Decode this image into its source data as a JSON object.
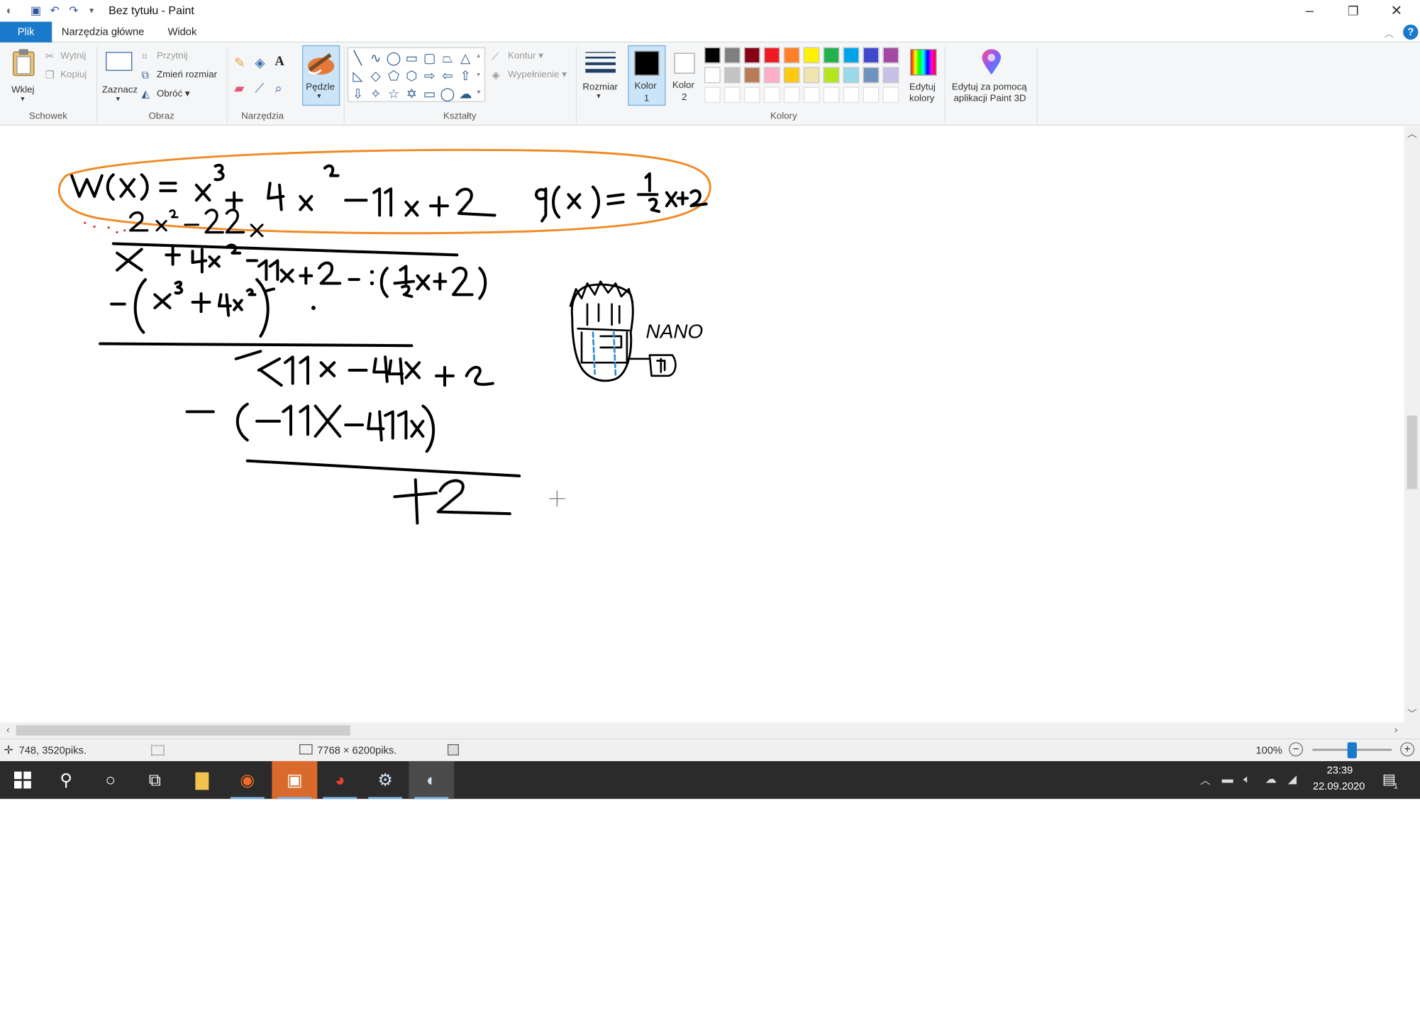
{
  "window": {
    "title": "Bez tytułu - Paint",
    "quick_access": [
      "save-icon",
      "undo-icon",
      "redo-icon",
      "customize-icon"
    ]
  },
  "tabs": [
    {
      "label": "Plik"
    },
    {
      "label": "Narzędzia główne"
    },
    {
      "label": "Widok"
    }
  ],
  "ribbon": {
    "groups": {
      "schowek": "Schowek",
      "obraz": "Obraz",
      "narzedzia": "Narzędzia",
      "ksztalty": "Kształty",
      "kolory": "Kolory"
    },
    "wklej": "Wklej",
    "wytnij": "Wytnij",
    "kopiuj": "Kopiuj",
    "zaznacz": "Zaznacz",
    "przytnij": "Przytnij",
    "zmien_rozmiar": "Zmień rozmiar",
    "obroc": "Obróć",
    "pedzle": "Pędzle",
    "kontur": "Kontur",
    "wypelnienie": "Wypełnienie",
    "rozmiar": "Rozmiar",
    "kolor1": "Kolor",
    "kolor1_num": "1",
    "kolor2": "Kolor",
    "kolor2_num": "2",
    "edytuj_kolory_1": "Edytuj",
    "edytuj_kolory_2": "kolory",
    "paint3d_1": "Edytuj za pomocą",
    "paint3d_2": "aplikacji Paint 3D",
    "color1_value": "#000000",
    "color2_value": "#ffffff",
    "palette_row1": [
      "#000000",
      "#7f7f7f",
      "#880015",
      "#ed1c24",
      "#ff7f27",
      "#fff200",
      "#22b14c",
      "#00a2e8",
      "#3f48cc",
      "#a349a4"
    ],
    "palette_row2": [
      "#ffffff",
      "#c3c3c3",
      "#b97a57",
      "#ffaec9",
      "#ffc90e",
      "#efe4b0",
      "#b5e61d",
      "#99d9ea",
      "#7092be",
      "#c8bfe7"
    ]
  },
  "canvas": {
    "text_nano": "NANO",
    "ink_color": "#000000",
    "highlight_color": "#f08a24"
  },
  "status": {
    "cursor_pos": "748, 3520piks.",
    "image_size": "7768 × 6200piks.",
    "zoom": "100%"
  },
  "taskbar": {
    "time": "23:39",
    "date": "22.09.2020",
    "notification_count": "1"
  }
}
